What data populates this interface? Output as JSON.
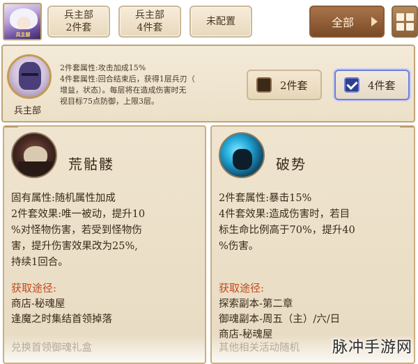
{
  "topbar": {
    "avatar_tag": "兵主部",
    "filters": [
      {
        "line1": "兵主部",
        "line2": "2件套"
      },
      {
        "line1": "兵主部",
        "line2": "4件套"
      },
      {
        "line1": "未配置",
        "line2": ""
      }
    ],
    "all_label": "全部"
  },
  "set_panel": {
    "name": "兵主部",
    "desc_lines": [
      "2件套属性:攻击加成15%",
      "4件套属性:回合结束后，获得1层兵刃（",
      "增益，状态）。每层将在造成伤害时无",
      "视目标75点防御，上限3层。"
    ],
    "piece2_label": "2件套",
    "piece4_label": "4件套",
    "piece4_checked": true
  },
  "cards": [
    {
      "name": "荒骷髅",
      "body_lines": [
        "固有属性:随机属性加成",
        "2件套效果:唯一被动，提升10",
        "%对怪物伤害，若受到怪物伤",
        "害，提升伤害效果改为25%,",
        "持续1回合。"
      ],
      "source_title": "获取途径:",
      "source_lines": [
        "商店-秘魂屋",
        "逢魔之时集结首领掉落"
      ],
      "faded_line": "兑换首领御魂礼盒"
    },
    {
      "name": "破势",
      "body_lines": [
        "2件套属性:暴击15%",
        "4件套效果:造成伤害时，若目",
        "标生命比例高于70%，提升40",
        "%伤害。"
      ],
      "source_title": "获取途径:",
      "source_lines": [
        "探索副本-第二章",
        "御魂副本-周五（主）/六/日",
        "商店-秘魂屋"
      ],
      "faded_line": "其他相关活动随机"
    }
  ],
  "watermark": "脉冲手游网",
  "colors": {
    "accent_blue": "#6d7fd6",
    "source_title": "#c24a1c",
    "panel_bg": "#ece0c8"
  }
}
